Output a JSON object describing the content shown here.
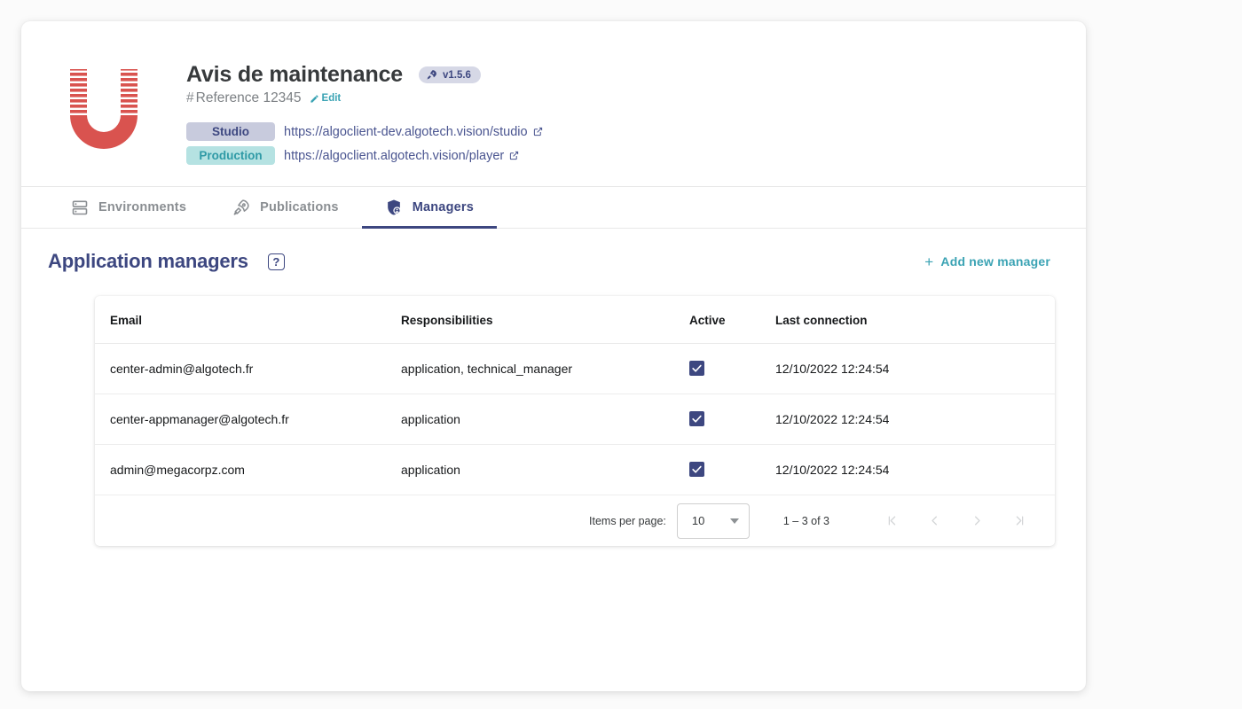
{
  "header": {
    "logo_name": "algotech-horseshoe-logo",
    "title": "Avis de maintenance",
    "version_badge": {
      "icon": "rocket-icon",
      "label": "v1.5.6"
    },
    "reference": {
      "hash": "#",
      "text": "Reference 12345"
    },
    "edit_link": {
      "icon": "pencil-icon",
      "label": "Edit"
    },
    "environments": [
      {
        "chip": "Studio",
        "url": "https://algoclient-dev.algotech.vision/studio",
        "icon": "external-link-icon"
      },
      {
        "chip": "Production",
        "url": "https://algoclient.algotech.vision/player",
        "icon": "external-link-icon"
      }
    ]
  },
  "tabs": [
    {
      "label": "Environments",
      "icon": "server-icon",
      "active": false
    },
    {
      "label": "Publications",
      "icon": "rocket-icon",
      "active": false
    },
    {
      "label": "Managers",
      "icon": "shield-user-icon",
      "active": true
    }
  ],
  "section": {
    "title": "Application managers",
    "help_icon_label": "?",
    "add_button": {
      "plus": "+",
      "label": "Add new manager"
    }
  },
  "table": {
    "columns": [
      "Email",
      "Responsibilities",
      "Active",
      "Last connection"
    ],
    "rows": [
      {
        "email": "center-admin@algotech.fr",
        "responsibilities": "application, technical_manager",
        "active": true,
        "last_connection": "12/10/2022 12:24:54"
      },
      {
        "email": "center-appmanager@algotech.fr",
        "responsibilities": "application",
        "active": true,
        "last_connection": "12/10/2022 12:24:54"
      },
      {
        "email": "admin@megacorpz.com",
        "responsibilities": "application",
        "active": true,
        "last_connection": "12/10/2022 12:24:54"
      }
    ]
  },
  "paginator": {
    "items_per_page_label": "Items per page:",
    "items_per_page_value": "10",
    "range_label": "1 – 3 of 3",
    "buttons": [
      "first-page",
      "previous-page",
      "next-page",
      "last-page"
    ]
  },
  "colors": {
    "navy": "#3d4780",
    "teal": "#3ba3b4",
    "logo_red": "#d9534f",
    "studio_chip_bg": "#c8cbdd",
    "production_chip_bg": "#b5e2e2"
  }
}
